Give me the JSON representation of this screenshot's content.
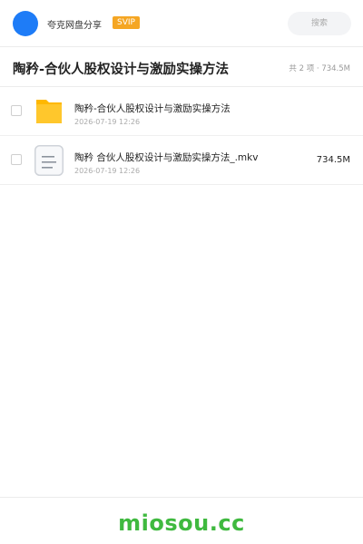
{
  "header": {
    "brand": "夸克网盘分享",
    "badge": "SVIP",
    "search_placeholder": "搜索"
  },
  "folder": {
    "title": "陶矜-合伙人股权设计与激励实操方法",
    "summary": "共 2 项 · 734.5M"
  },
  "files": [
    {
      "icon": "folder-icon",
      "name": "陶矜-合伙人股权设计与激励实操方法",
      "date": "2026-07-19 12:26",
      "size": ""
    },
    {
      "icon": "document-icon",
      "name": "陶矜 合伙人股权设计与激励实操方法_.mkv",
      "date": "2026-07-19 12:26",
      "size": "734.5M"
    }
  ],
  "footer": {
    "watermark": "miosou.cc"
  },
  "colors": {
    "accent": "#1e7cf7",
    "badge": "#f5a623",
    "folder": "#ffc300",
    "watermark": "#3fb93f"
  }
}
